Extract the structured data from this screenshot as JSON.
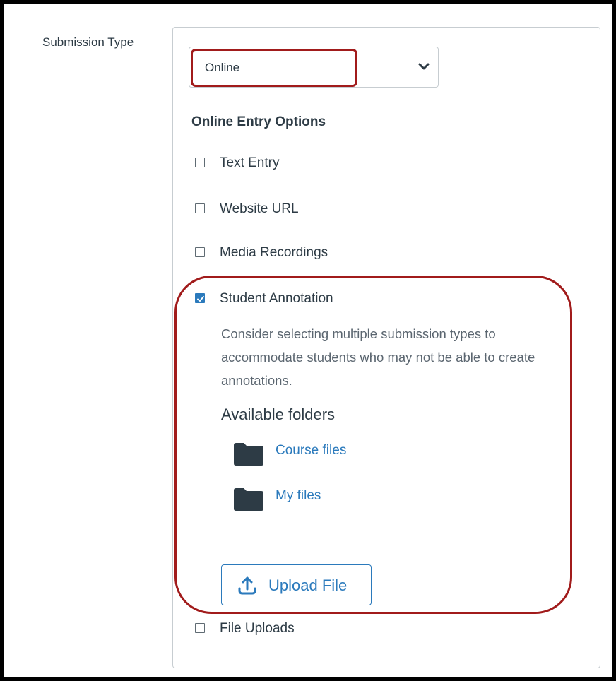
{
  "form": {
    "label": "Submission Type",
    "select": {
      "value": "Online"
    },
    "online_entry": {
      "title": "Online Entry Options",
      "options": [
        {
          "label": "Text Entry",
          "checked": false
        },
        {
          "label": "Website URL",
          "checked": false
        },
        {
          "label": "Media Recordings",
          "checked": false
        },
        {
          "label": "Student Annotation",
          "checked": true
        },
        {
          "label": "File Uploads",
          "checked": false
        }
      ],
      "annotation": {
        "help_text": "Consider selecting multiple submission types to accommodate students who may not be able to create annotations.",
        "folders_heading": "Available folders",
        "folders": [
          {
            "label": "Course files",
            "icon": "folder-icon"
          },
          {
            "label": "My files",
            "icon": "folder-icon"
          }
        ],
        "upload_button": {
          "label": "Upload File",
          "icon": "upload-icon"
        }
      }
    }
  },
  "colors": {
    "accent": "#2b7abc",
    "highlight": "#a11b1b",
    "text": "#2d3b45",
    "folder": "#2d3b45"
  }
}
